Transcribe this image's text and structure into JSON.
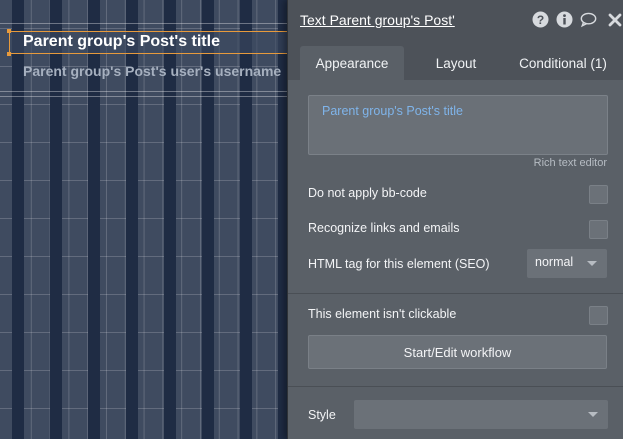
{
  "canvas": {
    "title_text": "Parent group's Post's title",
    "username_text": "Parent group's Post's user's username"
  },
  "panel": {
    "title": "Text Parent group's Post'",
    "header_icons": [
      "help-icon",
      "info-icon",
      "comment-icon",
      "close-icon"
    ],
    "tabs": [
      {
        "label": "Appearance",
        "active": true
      },
      {
        "label": "Layout",
        "active": false
      },
      {
        "label": "Conditional (1)",
        "active": false
      }
    ],
    "editor_content": "Parent group's Post's title",
    "editor_caption": "Rich text editor",
    "options": {
      "no_bbcode_label": "Do not apply bb-code",
      "recognize_links_label": "Recognize links and emails",
      "html_tag_label": "HTML tag for this element (SEO)",
      "html_tag_value": "normal",
      "not_clickable_label": "This element isn't clickable",
      "workflow_button": "Start/Edit workflow",
      "style_label": "Style",
      "style_value": ""
    }
  },
  "colors": {
    "selection_outline": "#e79a3c",
    "editor_text": "#7fb4ea",
    "panel_bg": "#5a6067",
    "canvas_bg": "#3f4b60",
    "column_band": "#1f2c44"
  }
}
